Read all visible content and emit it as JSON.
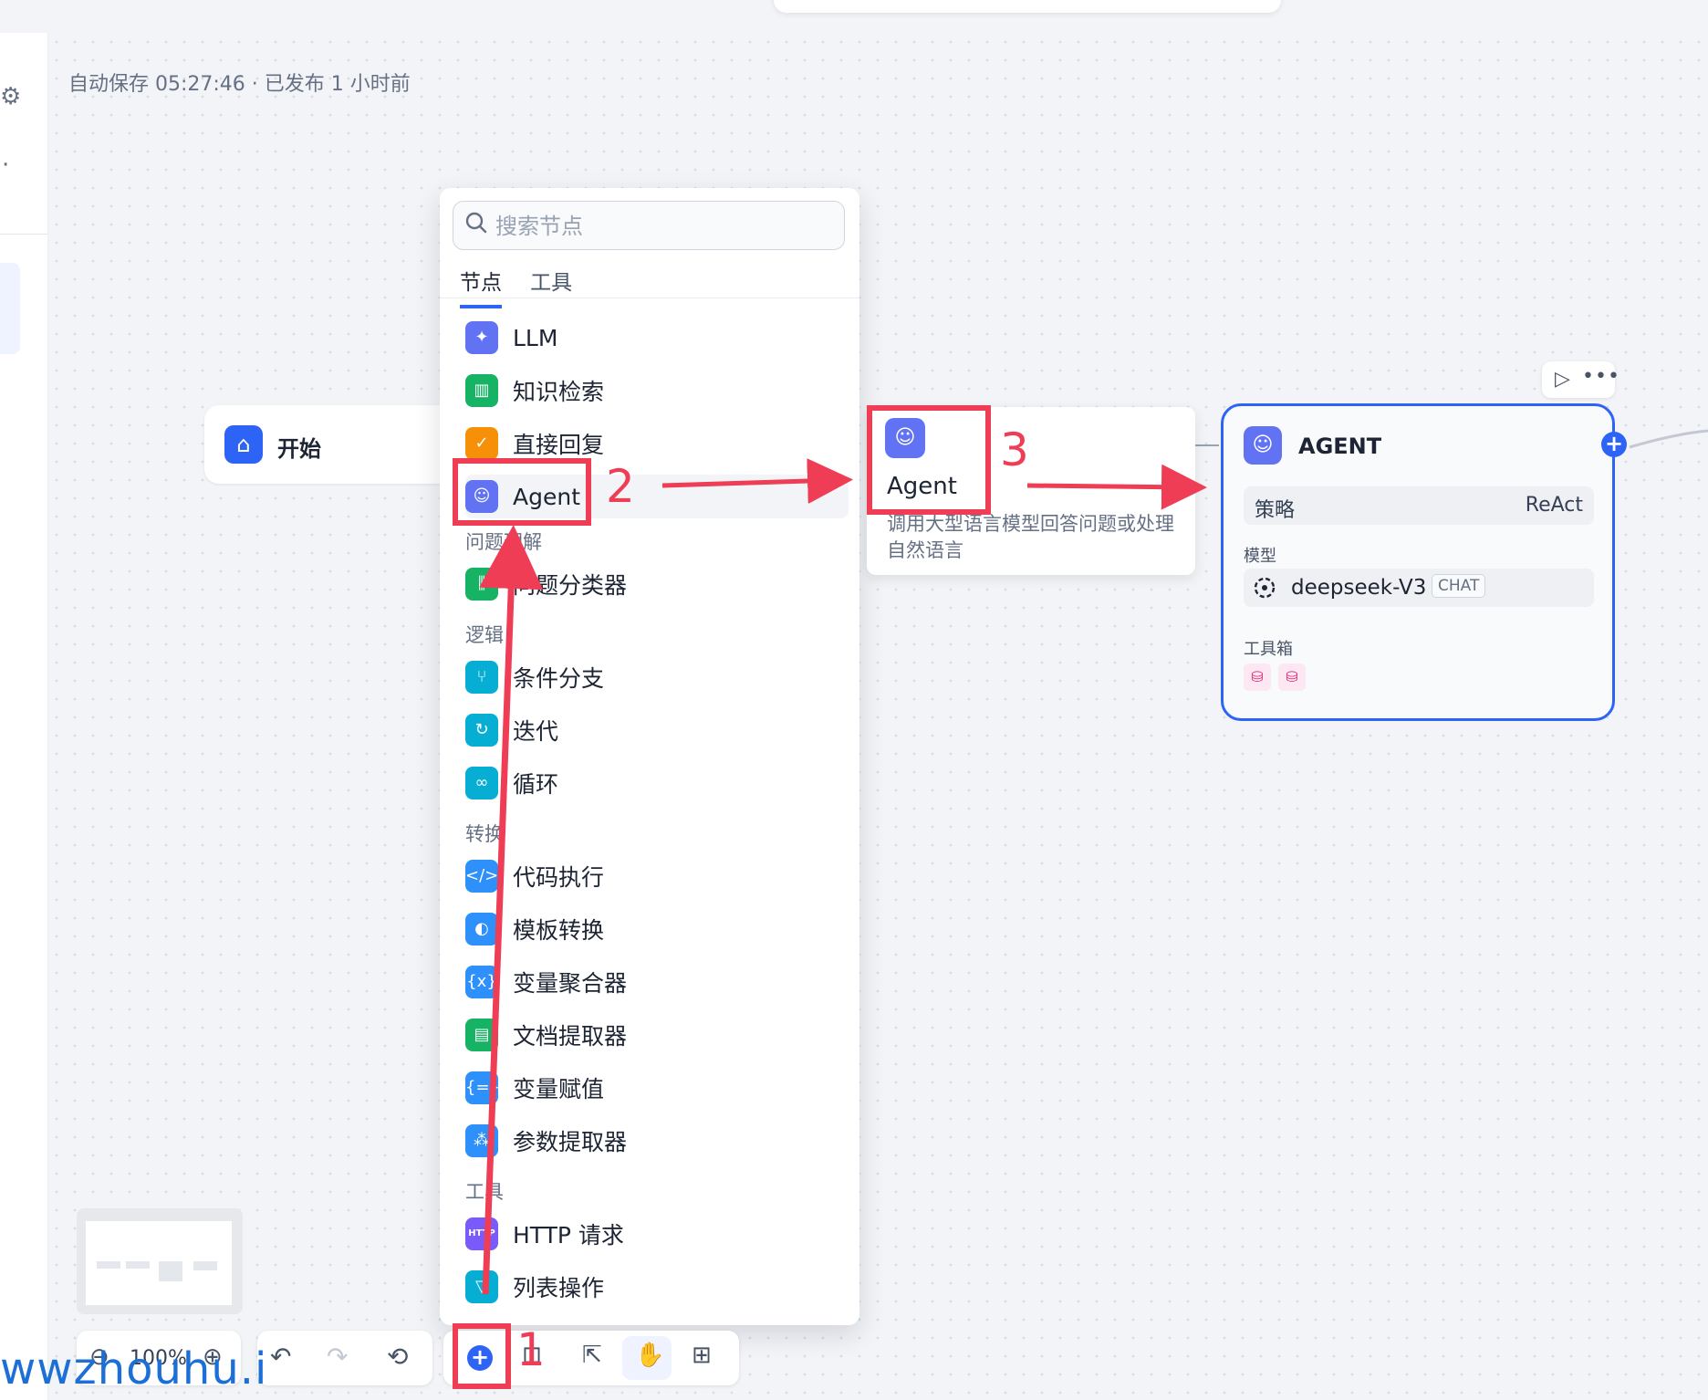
{
  "status": {
    "autosave": "自动保存 05:27:46 · 已发布 1 小时前"
  },
  "start_node": {
    "label": "开始"
  },
  "popup": {
    "search_placeholder": "搜索节点",
    "tabs": [
      {
        "label": "节点"
      },
      {
        "label": "工具"
      }
    ],
    "items": [
      {
        "label": "LLM",
        "color": "#6172f3",
        "icon": "llm-icon"
      },
      {
        "label": "知识检索",
        "color": "#16b364",
        "icon": "book-icon"
      },
      {
        "label": "直接回复",
        "color": "#f79009",
        "icon": "reply-icon"
      },
      {
        "label": "Agent",
        "color": "#6172f3",
        "icon": "agent-icon"
      },
      {
        "label": "问题分类器",
        "color": "#16b364",
        "icon": "classifier-icon"
      },
      {
        "label": "条件分支",
        "color": "#06aed4",
        "icon": "branch-icon"
      },
      {
        "label": "迭代",
        "color": "#06aed4",
        "icon": "iteration-icon"
      },
      {
        "label": "循环",
        "color": "#06aed4",
        "icon": "loop-icon"
      },
      {
        "label": "代码执行",
        "color": "#2e90fa",
        "icon": "code-icon"
      },
      {
        "label": "模板转换",
        "color": "#2e90fa",
        "icon": "template-icon"
      },
      {
        "label": "变量聚合器",
        "color": "#2e90fa",
        "icon": "variable-aggregator-icon"
      },
      {
        "label": "文档提取器",
        "color": "#16b364",
        "icon": "document-extractor-icon"
      },
      {
        "label": "变量赋值",
        "color": "#2e90fa",
        "icon": "variable-assign-icon"
      },
      {
        "label": "参数提取器",
        "color": "#2e90fa",
        "icon": "parameter-extractor-icon"
      },
      {
        "label": "HTTP 请求",
        "color": "#7a5af8",
        "icon": "http-icon"
      },
      {
        "label": "列表操作",
        "color": "#06aed4",
        "icon": "list-filter-icon"
      }
    ],
    "categories": [
      {
        "label": "问题理解"
      },
      {
        "label": "逻辑"
      },
      {
        "label": "转换"
      },
      {
        "label": "工具"
      }
    ]
  },
  "tooltip": {
    "title": "Agent",
    "description": "调用大型语言模型回答问题或处理自然语言"
  },
  "agent_node": {
    "title": "AGENT",
    "strategy_label": "策略",
    "strategy_value": "ReAct",
    "model_label": "模型",
    "model_name": "deepseek-V3",
    "model_badge": "CHAT",
    "toolbox_label": "工具箱"
  },
  "zoom": {
    "value": "100%"
  },
  "annotations": [
    "1",
    "2",
    "3"
  ],
  "watermark": "wwzhouhu.i",
  "colors": {
    "accent": "#2e64f5",
    "annotation": "#ee3d55"
  }
}
